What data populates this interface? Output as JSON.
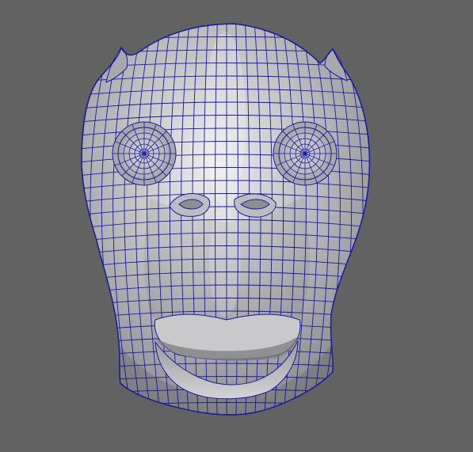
{
  "viewport": {
    "background_color": "#626262",
    "object": "head-mesh",
    "display_mode": "wireframe-on-shaded",
    "shading_color": "#b3b3b5",
    "wireframe_color": "#1a1a9c"
  }
}
